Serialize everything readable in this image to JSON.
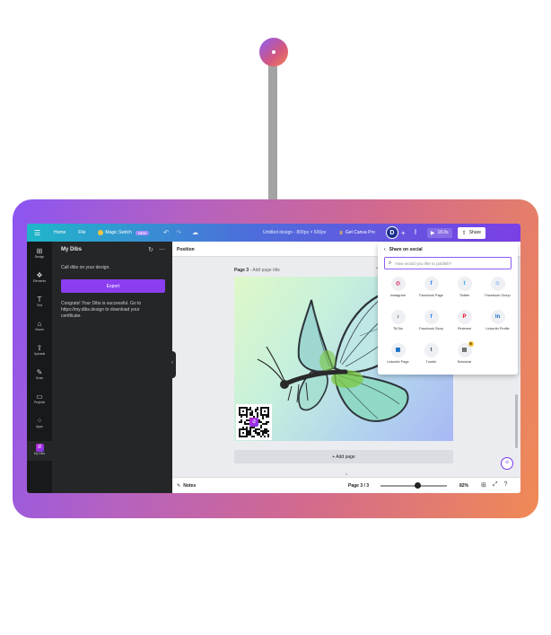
{
  "colors": {
    "accent": "#8b3ef0",
    "topbar_from": "#1fb6c9",
    "topbar_to": "#7b3fe4",
    "frame_from": "#8b55f2",
    "frame_to": "#f08a55",
    "panel_bg": "#252627",
    "rail_bg": "#18191b"
  },
  "topbar": {
    "menu_icon": "hamburger-icon",
    "home": "Home",
    "file": "File",
    "magic_switch": "Magic Switch",
    "magic_badge": "NEW",
    "undo_icon": "undo-icon",
    "redo_icon": "redo-icon",
    "cloud_icon": "cloud-saved-icon",
    "doc_title": "Untitled design - 800px × 600px",
    "get_pro": "Get Canva Pro",
    "avatar_initial": "D",
    "plus": "+",
    "analytics_icon": "bar-chart-icon",
    "present_time": "18.0s",
    "share": "Share"
  },
  "rail": [
    {
      "label": "Design",
      "icon": "design-icon",
      "glyph": "⊞"
    },
    {
      "label": "Elements",
      "icon": "elements-icon",
      "glyph": "❖"
    },
    {
      "label": "Text",
      "icon": "text-icon",
      "glyph": "T"
    },
    {
      "label": "Brand",
      "icon": "brand-icon",
      "glyph": "⌂"
    },
    {
      "label": "Uploads",
      "icon": "uploads-icon",
      "glyph": "⇪"
    },
    {
      "label": "Draw",
      "icon": "draw-icon",
      "glyph": "✎"
    },
    {
      "label": "Projects",
      "icon": "folder-icon",
      "glyph": "▭"
    },
    {
      "label": "Apps",
      "icon": "apps-icon",
      "glyph": "⁘"
    },
    {
      "label": "My Dibs",
      "icon": "my-dibs-icon",
      "glyph": "d"
    }
  ],
  "panel": {
    "title": "My Dibs",
    "hint": "Call dibs on your design.",
    "export": "Export",
    "message": "Congrats! Your Dibs is successful. Go to https://my.dibs.design to download your certificate."
  },
  "canvas": {
    "position_label": "Position",
    "page_label": "Page 3",
    "page_title_placeholder": "- Add page title",
    "add_page": "+ Add page"
  },
  "bottombar": {
    "notes": "Notes",
    "pages": "Page 3 / 3",
    "zoom_level": 82,
    "zoom": "82%"
  },
  "share_popup": {
    "title": "Share on social",
    "search_placeholder": "How would you like to publish?",
    "items": [
      {
        "label": "Instagram",
        "icon": "instagram-icon",
        "glyph": "◎",
        "color": "#e1306c"
      },
      {
        "label": "Facebook Page",
        "icon": "facebook-icon",
        "glyph": "f",
        "color": "#1877f2"
      },
      {
        "label": "Twitter",
        "icon": "twitter-icon",
        "glyph": "t",
        "color": "#1da1f2"
      },
      {
        "label": "Facebook Group",
        "icon": "facebook-group-icon",
        "glyph": "☺",
        "color": "#1877f2"
      },
      {
        "label": "TikTok",
        "icon": "tiktok-icon",
        "glyph": "♪",
        "color": "#111111"
      },
      {
        "label": "Facebook Story",
        "icon": "facebook-story-icon",
        "glyph": "f",
        "color": "#1877f2"
      },
      {
        "label": "Pinterest",
        "icon": "pinterest-icon",
        "glyph": "P",
        "color": "#e60023"
      },
      {
        "label": "LinkedIn Profile",
        "icon": "linkedin-icon",
        "glyph": "in",
        "color": "#0a66c2"
      },
      {
        "label": "LinkedIn Page",
        "icon": "linkedin-page-icon",
        "glyph": "▦",
        "color": "#0a66c2"
      },
      {
        "label": "Tumblr",
        "icon": "tumblr-icon",
        "glyph": "t",
        "color": "#36465d"
      },
      {
        "label": "Schedule",
        "icon": "calendar-icon",
        "glyph": "▤",
        "color": "#444444"
      }
    ]
  }
}
